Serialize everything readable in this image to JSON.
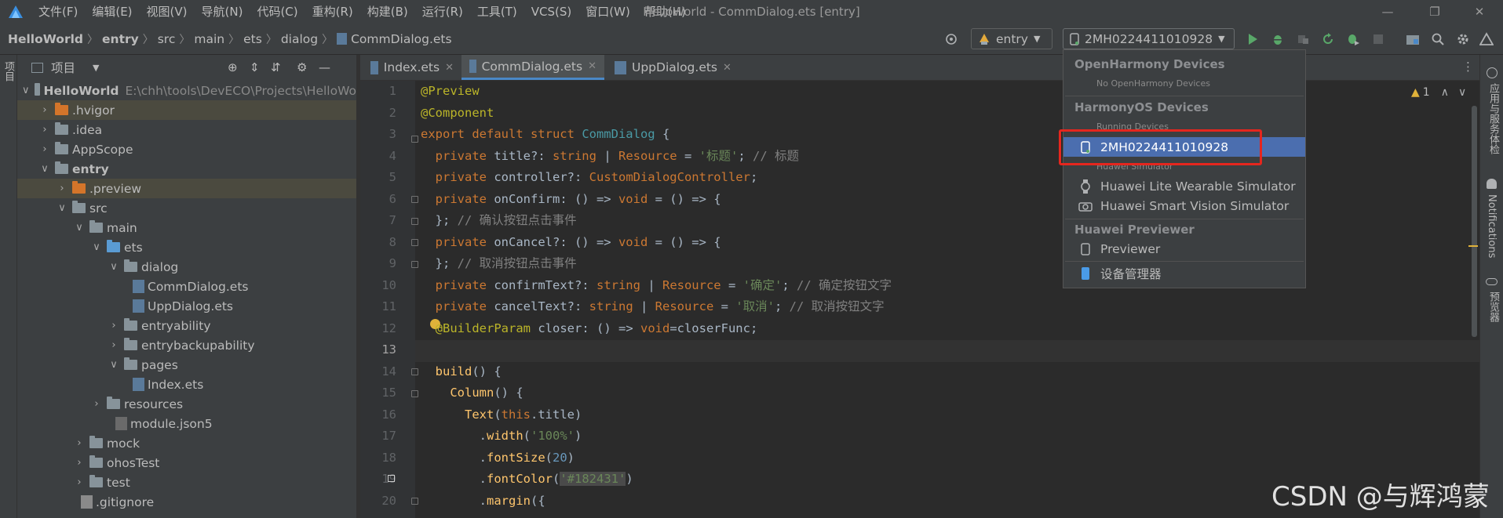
{
  "window": {
    "title": "HelloWorld - CommDialog.ets [entry]"
  },
  "menu": [
    "文件(F)",
    "编辑(E)",
    "视图(V)",
    "导航(N)",
    "代码(C)",
    "重构(R)",
    "构建(B)",
    "运行(R)",
    "工具(T)",
    "VCS(S)",
    "窗口(W)",
    "帮助(H)"
  ],
  "breadcrumb": [
    "HelloWorld",
    "entry",
    "src",
    "main",
    "ets",
    "dialog",
    "CommDialog.ets"
  ],
  "toolbar": {
    "module": "entry",
    "device": "2MH0224411010928"
  },
  "leftstrip": {
    "label": "项目"
  },
  "project": {
    "header": "项目",
    "tree": [
      {
        "name": "HelloWorld",
        "path": "E:\\chh\\tools\\DevECO\\Projects\\HelloWo"
      },
      {
        "name": ".hvigor"
      },
      {
        "name": ".idea"
      },
      {
        "name": "AppScope"
      },
      {
        "name": "entry"
      },
      {
        "name": ".preview"
      },
      {
        "name": "src"
      },
      {
        "name": "main"
      },
      {
        "name": "ets"
      },
      {
        "name": "dialog"
      },
      {
        "name": "CommDialog.ets"
      },
      {
        "name": "UppDialog.ets"
      },
      {
        "name": "entryability"
      },
      {
        "name": "entrybackupability"
      },
      {
        "name": "pages"
      },
      {
        "name": "Index.ets"
      },
      {
        "name": "resources"
      },
      {
        "name": "module.json5"
      },
      {
        "name": "mock"
      },
      {
        "name": "ohosTest"
      },
      {
        "name": "test"
      },
      {
        "name": ".gitignore"
      }
    ]
  },
  "tabs": [
    "Index.ets",
    "CommDialog.ets",
    "UppDialog.ets"
  ],
  "editor": {
    "warning_count": "1",
    "line_numbers": [
      "1",
      "2",
      "3",
      "4",
      "5",
      "6",
      "7",
      "8",
      "9",
      "10",
      "11",
      "12",
      "13",
      "14",
      "15",
      "16",
      "17",
      "18",
      "19",
      "20"
    ]
  },
  "dropdown": {
    "group1": "OpenHarmony Devices",
    "group1_empty": "No OpenHarmony Devices",
    "group2": "HarmonyOS Devices",
    "group2_sub": "Running Devices",
    "selected_device": "2MH0224411010928",
    "group2_sub2": "Huawei Simulator",
    "sim1": "Huawei Lite Wearable Simulator",
    "sim2": "Huawei Smart Vision Simulator",
    "group3": "Huawei Previewer",
    "previewer": "Previewer",
    "device_manager": "设备管理器"
  },
  "rightstrip": {
    "label1": "应用与服务体检",
    "label2": "Notifications",
    "label3": "预览器"
  },
  "watermark": "CSDN @与辉鸿蒙"
}
